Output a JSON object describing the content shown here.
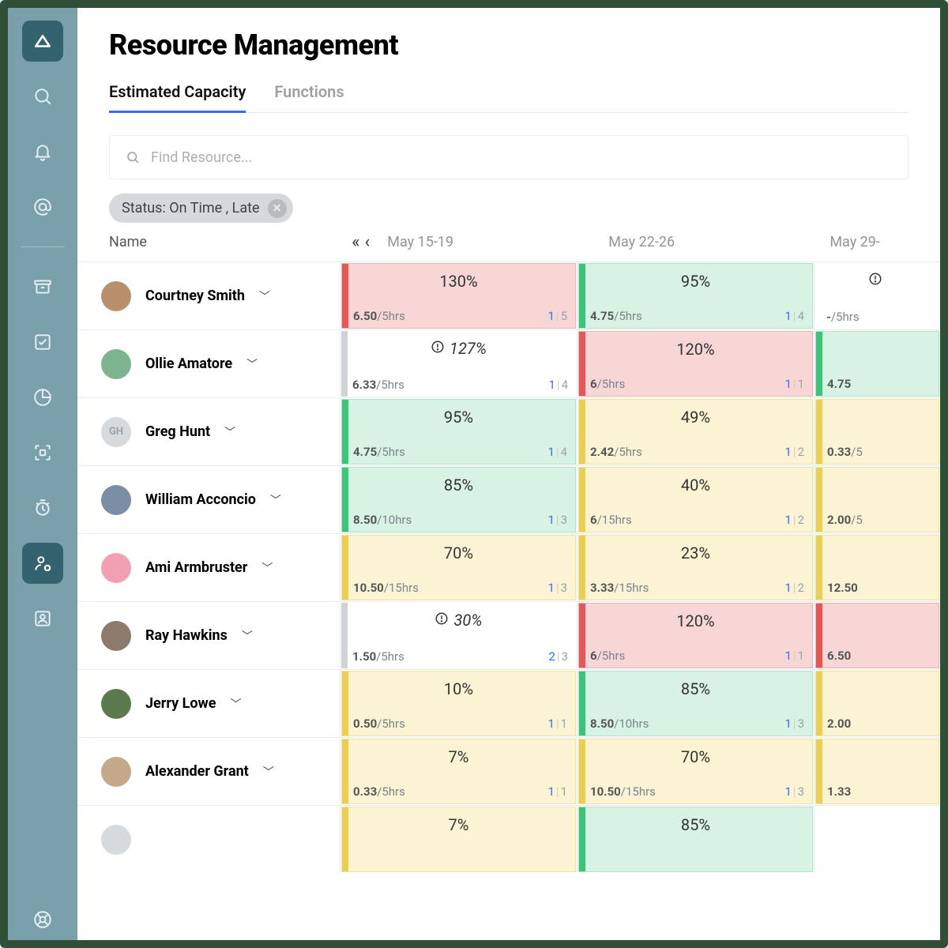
{
  "header": {
    "title": "Resource Management"
  },
  "tabs": [
    {
      "label": "Estimated Capacity",
      "active": true
    },
    {
      "label": "Functions",
      "active": false
    }
  ],
  "search": {
    "placeholder": "Find Resource..."
  },
  "filter_chip": {
    "label": "Status: On Time , Late"
  },
  "columns": {
    "name_label": "Name",
    "dates": [
      "May 15-19",
      "May 22-26",
      "May 29-"
    ]
  },
  "colors": {
    "accent": "#3d6af2",
    "sidebar": "#7aa0ab",
    "sidebar_dark": "#34636f",
    "red_bg": "#f8d6d6",
    "green_bg": "#d8f2e3",
    "yellow_bg": "#fbf3d3"
  },
  "rows": [
    {
      "name": "Courtney Smith",
      "avatar_class": "a1",
      "cells": [
        {
          "pct": "130%",
          "hrs_a": "6.50",
          "hrs_b": "/5hrs",
          "c1": "1",
          "c2": "5",
          "bg": "red",
          "stripe": "red"
        },
        {
          "pct": "95%",
          "hrs_a": "4.75",
          "hrs_b": "/5hrs",
          "c1": "1",
          "c2": "4",
          "bg": "green",
          "stripe": "green"
        },
        {
          "pct": "",
          "hrs_a": "-",
          "hrs_b": "/5hrs",
          "c1": "",
          "c2": "",
          "bg": "white",
          "stripe": "",
          "alert": true
        }
      ]
    },
    {
      "name": "Ollie Amatore",
      "avatar_class": "a2",
      "cells": [
        {
          "pct": "127%",
          "hrs_a": "6.33",
          "hrs_b": "/5hrs",
          "c1": "1",
          "c2": "4",
          "bg": "white",
          "stripe": "grey",
          "alert": true,
          "ital": true
        },
        {
          "pct": "120%",
          "hrs_a": "6",
          "hrs_b": "/5hrs",
          "c1": "1",
          "c2": "1",
          "bg": "red",
          "stripe": "red"
        },
        {
          "pct": "",
          "hrs_a": "4.75",
          "hrs_b": "",
          "c1": "",
          "c2": "",
          "bg": "green",
          "stripe": "green"
        }
      ]
    },
    {
      "name": "Greg Hunt",
      "avatar_class": "a3",
      "initials": "GH",
      "cells": [
        {
          "pct": "95%",
          "hrs_a": "4.75",
          "hrs_b": "/5hrs",
          "c1": "1",
          "c2": "4",
          "bg": "green",
          "stripe": "green"
        },
        {
          "pct": "49%",
          "hrs_a": "2.42",
          "hrs_b": "/5hrs",
          "c1": "1",
          "c2": "2",
          "bg": "yel",
          "stripe": "yel"
        },
        {
          "pct": "",
          "hrs_a": "0.33",
          "hrs_b": "/5",
          "c1": "",
          "c2": "",
          "bg": "yel",
          "stripe": "yel"
        }
      ]
    },
    {
      "name": "William Acconcio",
      "avatar_class": "a4",
      "cells": [
        {
          "pct": "85%",
          "hrs_a": "8.50",
          "hrs_b": "/10hrs",
          "c1": "1",
          "c2": "3",
          "bg": "green",
          "stripe": "green"
        },
        {
          "pct": "40%",
          "hrs_a": "6",
          "hrs_b": "/15hrs",
          "c1": "1",
          "c2": "2",
          "bg": "yel",
          "stripe": "yel"
        },
        {
          "pct": "",
          "hrs_a": "2.00",
          "hrs_b": "/5",
          "c1": "",
          "c2": "",
          "bg": "yel",
          "stripe": "yel"
        }
      ]
    },
    {
      "name": "Ami Armbruster",
      "avatar_class": "a5",
      "cells": [
        {
          "pct": "70%",
          "hrs_a": "10.50",
          "hrs_b": "/15hrs",
          "c1": "1",
          "c2": "3",
          "bg": "yel",
          "stripe": "yel"
        },
        {
          "pct": "23%",
          "hrs_a": "3.33",
          "hrs_b": "/15hrs",
          "c1": "1",
          "c2": "2",
          "bg": "yel",
          "stripe": "yel"
        },
        {
          "pct": "",
          "hrs_a": "12.50",
          "hrs_b": "",
          "c1": "",
          "c2": "",
          "bg": "yel",
          "stripe": "yel"
        }
      ]
    },
    {
      "name": "Ray Hawkins",
      "avatar_class": "a6",
      "cells": [
        {
          "pct": "30%",
          "hrs_a": "1.50",
          "hrs_b": "/5hrs",
          "c1": "2",
          "c2": "3",
          "bg": "white",
          "stripe": "grey",
          "alert": true,
          "ital": true
        },
        {
          "pct": "120%",
          "hrs_a": "6",
          "hrs_b": "/5hrs",
          "c1": "1",
          "c2": "1",
          "bg": "red",
          "stripe": "red"
        },
        {
          "pct": "",
          "hrs_a": "6.50",
          "hrs_b": "",
          "c1": "",
          "c2": "",
          "bg": "red",
          "stripe": "red"
        }
      ]
    },
    {
      "name": "Jerry Lowe",
      "avatar_class": "a7",
      "cells": [
        {
          "pct": "10%",
          "hrs_a": "0.50",
          "hrs_b": "/5hrs",
          "c1": "1",
          "c2": "1",
          "bg": "yel",
          "stripe": "yel"
        },
        {
          "pct": "85%",
          "hrs_a": "8.50",
          "hrs_b": "/10hrs",
          "c1": "1",
          "c2": "3",
          "bg": "green",
          "stripe": "green"
        },
        {
          "pct": "",
          "hrs_a": "2.00",
          "hrs_b": "",
          "c1": "",
          "c2": "",
          "bg": "yel",
          "stripe": "yel"
        }
      ]
    },
    {
      "name": "Alexander Grant",
      "avatar_class": "a8",
      "cells": [
        {
          "pct": "7%",
          "hrs_a": "0.33",
          "hrs_b": "/5hrs",
          "c1": "1",
          "c2": "1",
          "bg": "yel",
          "stripe": "yel"
        },
        {
          "pct": "70%",
          "hrs_a": "10.50",
          "hrs_b": "/15hrs",
          "c1": "1",
          "c2": "3",
          "bg": "yel",
          "stripe": "yel"
        },
        {
          "pct": "",
          "hrs_a": "1.33",
          "hrs_b": "",
          "c1": "",
          "c2": "",
          "bg": "yel",
          "stripe": "yel"
        }
      ]
    },
    {
      "name": "",
      "avatar_class": "a3",
      "cells": [
        {
          "pct": "7%",
          "hrs_a": "",
          "hrs_b": "",
          "c1": "",
          "c2": "",
          "bg": "yel",
          "stripe": "yel"
        },
        {
          "pct": "85%",
          "hrs_a": "",
          "hrs_b": "",
          "c1": "",
          "c2": "",
          "bg": "green",
          "stripe": "green"
        },
        {
          "pct": "",
          "hrs_a": "",
          "hrs_b": "",
          "c1": "",
          "c2": "",
          "bg": "white",
          "stripe": ""
        }
      ]
    }
  ]
}
